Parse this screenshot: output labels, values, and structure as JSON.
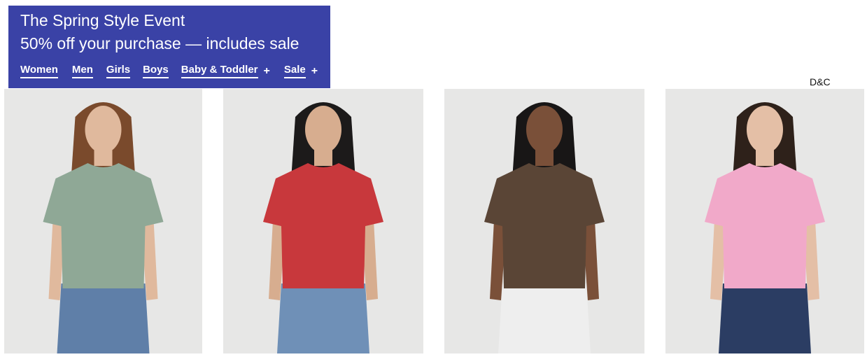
{
  "promo": {
    "title": "The Spring Style Event",
    "offer": "50% off your purchase — includes sale",
    "background": "#3a42a6",
    "nav": [
      {
        "label": "Women"
      },
      {
        "label": "Men"
      },
      {
        "label": "Girls"
      },
      {
        "label": "Boys"
      },
      {
        "label": "Baby & Toddler",
        "expand": "+"
      },
      {
        "label": "Sale",
        "expand": "+"
      }
    ]
  },
  "brand_label": "D&C",
  "products": [
    {
      "shirt_color": "#8fa896",
      "hair_color": "#7a4a2c",
      "skin_color": "#e0b99d",
      "pants_color": "#5f7fa8",
      "image": "model-in-green-tee"
    },
    {
      "shirt_color": "#c8383c",
      "hair_color": "#1c1a1a",
      "skin_color": "#d7ad8f",
      "pants_color": "#6f90b7",
      "image": "model-in-red-tee"
    },
    {
      "shirt_color": "#5a4536",
      "hair_color": "#181616",
      "skin_color": "#7a5039",
      "pants_color": "#eeeeee",
      "image": "model-in-brown-tee"
    },
    {
      "shirt_color": "#f1a9c9",
      "hair_color": "#2e211a",
      "skin_color": "#e4bfa6",
      "pants_color": "#2b3d63",
      "image": "model-in-pink-tee"
    }
  ]
}
